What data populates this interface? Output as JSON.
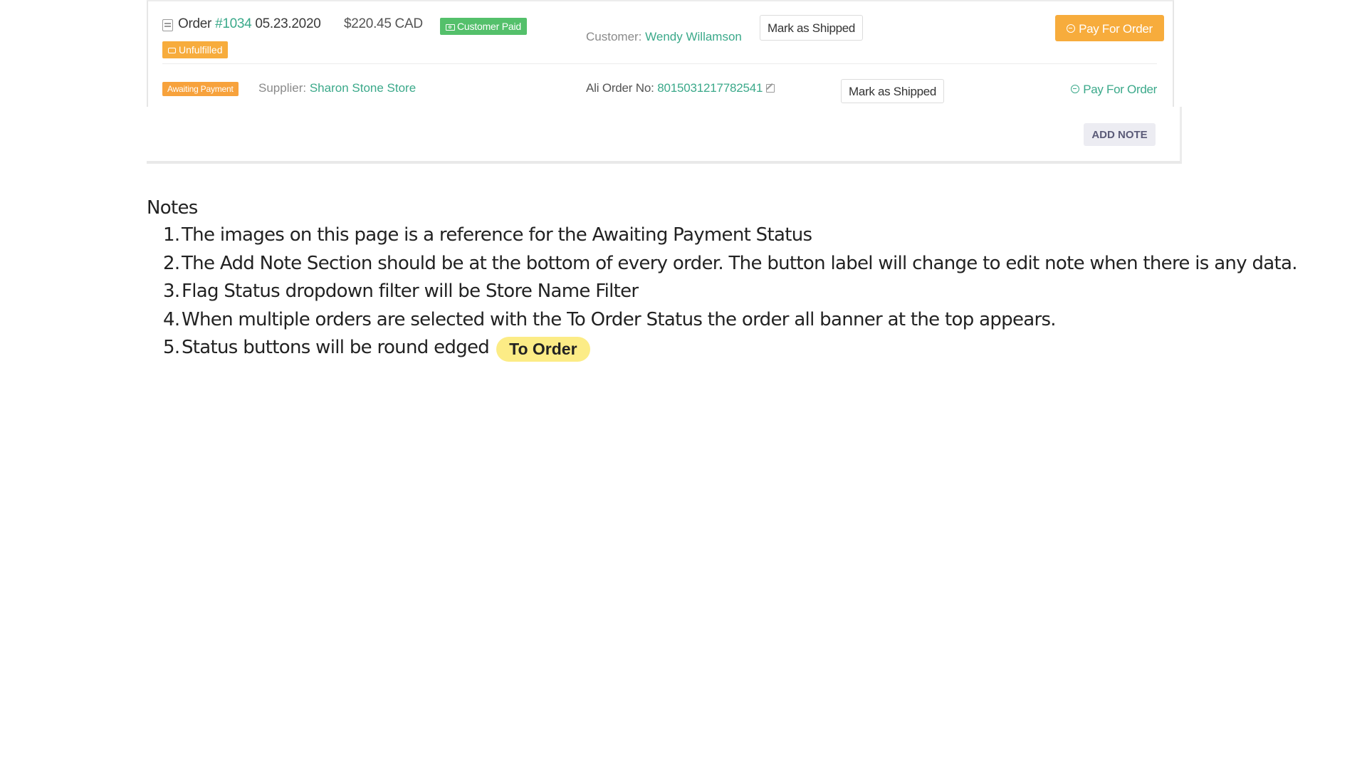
{
  "order": {
    "label": "Order",
    "number": "#1034",
    "date": "05.23.2020",
    "amount": "$220.45 CAD",
    "payment_badge": "Customer Paid",
    "fulfillment_badge": "Unfulfilled",
    "customer_label": "Customer:",
    "customer_name": "Wendy Willamson",
    "mark_shipped_label": "Mark as Shipped",
    "pay_label": "Pay For Order"
  },
  "supplier_row": {
    "status_badge": "Awaiting Payment",
    "supplier_label": "Supplier:",
    "supplier_name": "Sharon Stone Store",
    "ali_label": "Ali Order No:",
    "ali_number": "8015031217782541",
    "mark_shipped_label": "Mark as Shipped",
    "pay_label": "Pay For Order"
  },
  "note": {
    "add_label": "ADD NOTE"
  },
  "notes": {
    "title": "Notes",
    "items": [
      "The images on this page is a reference for the Awaiting Payment Status",
      "The Add Note Section should be at the bottom of every order. The button label will change to edit note when there is any data.",
      "Flag Status dropdown filter will be Store Name Filter",
      "When multiple orders are selected with the To Order Status the order all banner at the top appears.",
      "Status buttons will be round edged"
    ],
    "example_pill": "To Order"
  },
  "colors": {
    "accent_green": "#3ba98a",
    "paid_green": "#54c06b",
    "orange": "#f7ac3c",
    "pill_yellow": "#fcec86"
  }
}
